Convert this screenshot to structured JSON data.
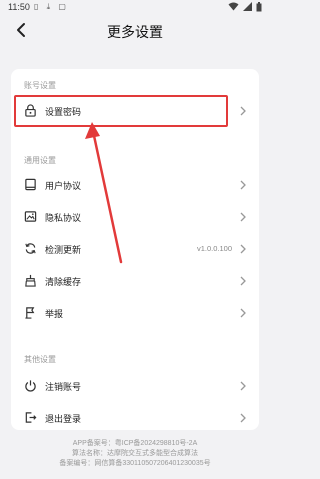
{
  "status": {
    "time": "11:50"
  },
  "header": {
    "title": "更多设置"
  },
  "sections": {
    "account": "账号设置",
    "general": "通用设置",
    "other": "其他设置"
  },
  "rows": {
    "password": {
      "label": "设置密码",
      "icon": "lock-icon"
    },
    "user_agreement": {
      "label": "用户协议",
      "icon": "book-icon"
    },
    "privacy": {
      "label": "隐私协议",
      "icon": "image-icon"
    },
    "update": {
      "label": "检测更新",
      "value": "v1.0.0.100",
      "icon": "refresh-icon"
    },
    "clear_cache": {
      "label": "清除缓存",
      "icon": "broom-icon"
    },
    "report": {
      "label": "举报",
      "icon": "flag-icon"
    },
    "cancel_account": {
      "label": "注销账号",
      "icon": "power-icon"
    },
    "logout": {
      "label": "退出登录",
      "icon": "logout-icon"
    }
  },
  "footer": {
    "line1": "APP备案号：粤ICP备2024298810号-2A",
    "line2": "算法名称：达摩院交互式多能型合成算法",
    "line3": "备案编号：网信算备330110507206401230035号"
  },
  "colors": {
    "highlight": "#e23a3a",
    "background": "#f2f2f4"
  }
}
